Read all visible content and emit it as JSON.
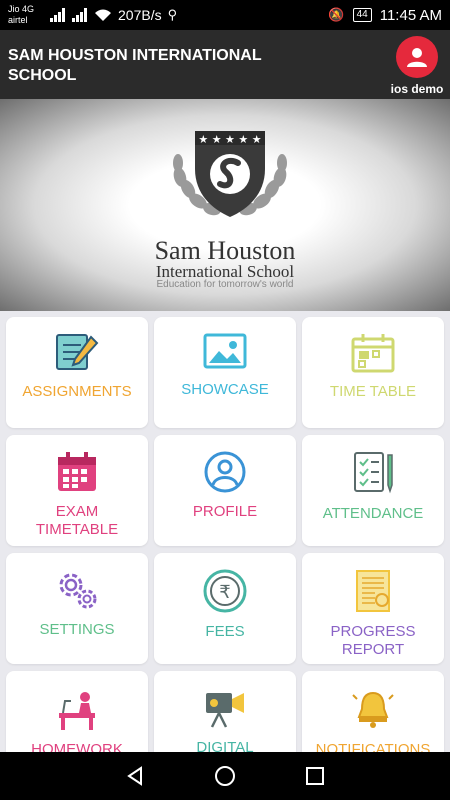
{
  "status_bar": {
    "carrier_line1": "Jio 4G",
    "carrier_line2": "airtel",
    "net_speed": "207B/s",
    "battery": "44",
    "time": "11:45 AM"
  },
  "header": {
    "title": "SAM HOUSTON INTERNATIONAL SCHOOL",
    "user_name": "ios demo"
  },
  "banner": {
    "school_name": "Sam Houston",
    "school_subtitle": "International School",
    "tagline": "Education for tomorrow's world"
  },
  "colors": {
    "orange": "#f0a531",
    "cyan": "#3fb8d9",
    "lime": "#cfd870",
    "pink": "#e0417f",
    "blue": "#3a93d6",
    "green": "#5fbf8a",
    "purple": "#8a62c6",
    "teal": "#46b5a4",
    "gold": "#f2c53d"
  },
  "tiles": [
    {
      "label": "ASSIGNMENTS",
      "icon": "assignment-icon"
    },
    {
      "label": "SHOWCASE",
      "icon": "image-icon"
    },
    {
      "label": "TIME TABLE",
      "icon": "timetable-icon"
    },
    {
      "label": "EXAM TIMETABLE",
      "icon": "calendar-icon"
    },
    {
      "label": "PROFILE",
      "icon": "user-icon"
    },
    {
      "label": "ATTENDANCE",
      "icon": "checklist-icon"
    },
    {
      "label": "SETTINGS",
      "icon": "gear-icon"
    },
    {
      "label": "FEES",
      "icon": "rupee-coin-icon"
    },
    {
      "label": "PROGRESS REPORT",
      "icon": "report-icon"
    },
    {
      "label": "HOMEWORK",
      "icon": "desk-icon"
    },
    {
      "label": "DIGITAL",
      "icon": "video-camera-icon"
    },
    {
      "label": "NOTIFICATIONS",
      "icon": "bell-icon"
    }
  ]
}
